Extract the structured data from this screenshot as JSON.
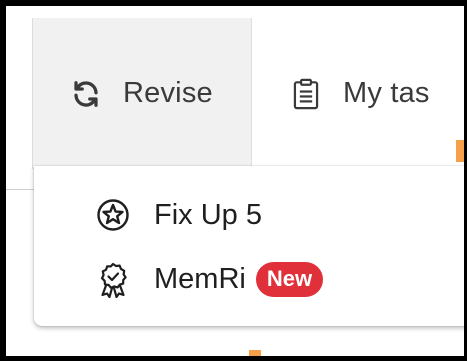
{
  "nav": {
    "tabs": [
      {
        "label": "Revise",
        "icon": "refresh-icon"
      },
      {
        "label": "My tas",
        "icon": "clipboard-icon"
      }
    ]
  },
  "dropdown": {
    "items": [
      {
        "label": "Fix Up 5",
        "icon": "star-badge-icon"
      },
      {
        "label": "MemRi",
        "icon": "award-ribbon-icon",
        "badge": "New"
      }
    ]
  },
  "colors": {
    "badge_bg": "#e0303a",
    "active_tab_bg": "#f1f1f1",
    "accent_orange": "#f7a04a"
  }
}
